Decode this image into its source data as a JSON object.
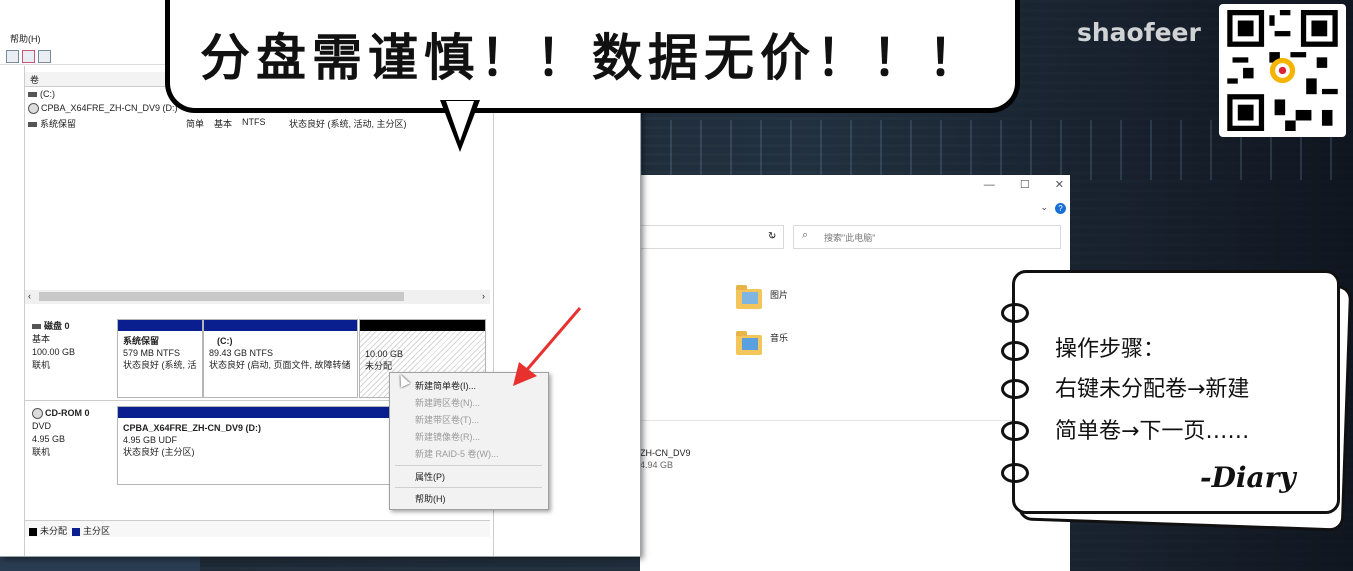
{
  "banner": {
    "text": "分盘需谨慎！！数据无价！！！"
  },
  "watermark": "shaofeer",
  "disk_mgmt": {
    "menu_help": "帮助(H)",
    "col_volume": "卷",
    "volumes": [
      {
        "name": "(C:)",
        "layout": "",
        "type": "",
        "fs": "",
        "status": ""
      },
      {
        "name": "CPBA_X64FRE_ZH-CN_DV9 (D:)",
        "layout": "",
        "type": "",
        "fs": "",
        "status": ""
      },
      {
        "name": "系统保留",
        "layout": "简单",
        "type": "基本",
        "fs": "NTFS",
        "status": "状态良好 (系统, 活动, 主分区)"
      }
    ],
    "scroll_left": "‹",
    "scroll_right": "›",
    "disk0": {
      "title": "磁盘 0",
      "type": "基本",
      "size": "100.00 GB",
      "state": "联机",
      "partitions": [
        {
          "name": "系统保留",
          "size": "579 MB NTFS",
          "status": "状态良好 (系统, 活"
        },
        {
          "name": "(C:)",
          "size": "89.43 GB NTFS",
          "status": "状态良好 (启动, 页面文件, 故障转储"
        },
        {
          "name": "",
          "size": "10.00 GB",
          "status": "未分配"
        }
      ]
    },
    "cdrom0": {
      "title": "CD-ROM 0",
      "type": "DVD",
      "size": "4.95 GB",
      "state": "联机",
      "partition": {
        "name": "CPBA_X64FRE_ZH-CN_DV9  (D:)",
        "size": "4.95 GB UDF",
        "status": "状态良好 (主分区)"
      }
    },
    "legend": {
      "unallocated": "未分配",
      "primary": "主分区"
    },
    "context_menu": {
      "items": [
        {
          "label": "新建简单卷(I)...",
          "enabled": true
        },
        {
          "label": "新建跨区卷(N)...",
          "enabled": false
        },
        {
          "label": "新建带区卷(T)...",
          "enabled": false
        },
        {
          "label": "新建镜像卷(R)...",
          "enabled": false
        },
        {
          "label": "新建 RAID-5 卷(W)...",
          "enabled": false
        },
        {
          "label": "属性(P)",
          "enabled": true
        },
        {
          "label": "帮助(H)",
          "enabled": true
        }
      ]
    }
  },
  "explorer": {
    "btn_min": "—",
    "btn_max": "☐",
    "btn_close": "✕",
    "search_placeholder": "搜索\"此电脑\"",
    "folders": [
      {
        "label": "图片"
      },
      {
        "label": "音乐"
      }
    ],
    "dvd_name": "ZH-CN_DV9",
    "dvd_size": "4.94 GB"
  },
  "notebook": {
    "lines": [
      "操作步骤：",
      "右键未分配卷→新建",
      "简单卷→下一页……"
    ],
    "signature": "-Diary"
  },
  "colors": {
    "accent_blue": "#0a1f8f",
    "arrow_red": "#e8312f",
    "unallocated_black": "#000000"
  }
}
